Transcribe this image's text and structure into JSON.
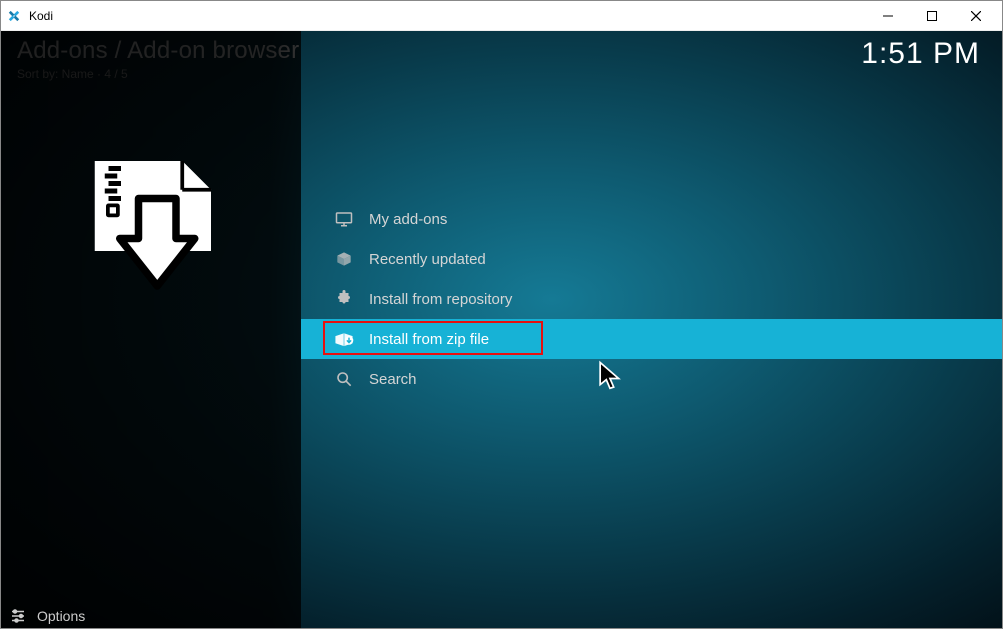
{
  "window": {
    "title": "Kodi"
  },
  "header": {
    "breadcrumb": "Add-ons / Add-on browser",
    "sortline": "Sort by: Name  ·  4 / 5",
    "clock": "1:51 PM"
  },
  "list": {
    "items": [
      {
        "label": "My add-ons"
      },
      {
        "label": "Recently updated"
      },
      {
        "label": "Install from repository"
      },
      {
        "label": "Install from zip file"
      },
      {
        "label": "Search"
      }
    ]
  },
  "footer": {
    "options": "Options"
  }
}
